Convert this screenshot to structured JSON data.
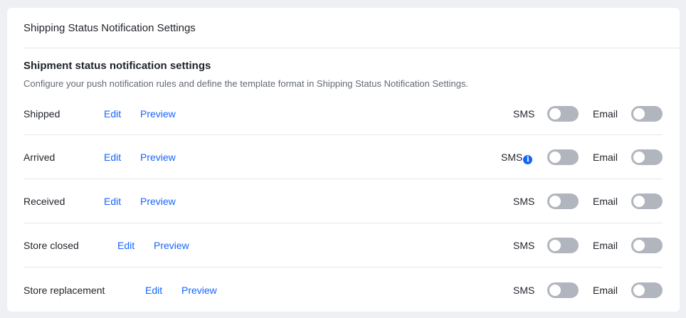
{
  "card": {
    "title": "Shipping Status Notification Settings"
  },
  "section": {
    "title": "Shipment status notification settings",
    "description": "Configure your push notification rules and define the template format in Shipping Status Notification Settings."
  },
  "rows": [
    {
      "label": "Shipped",
      "edit": "Edit",
      "preview": "Preview",
      "sms_label": "SMS",
      "email_label": "Email",
      "sms_enabled": false,
      "email_enabled": false
    },
    {
      "label": "Arrived",
      "edit": "Edit",
      "preview": "Preview",
      "sms_label": "SMS",
      "email_label": "Email",
      "sms_enabled": false,
      "email_enabled": false,
      "sms_info_icon": "info-icon"
    },
    {
      "label": "Received",
      "edit": "Edit",
      "preview": "Preview",
      "sms_label": "SMS",
      "email_label": "Email",
      "sms_enabled": false,
      "email_enabled": false
    },
    {
      "label": "Store closed",
      "edit": "Edit",
      "preview": "Preview",
      "sms_label": "SMS",
      "email_label": "Email",
      "sms_enabled": false,
      "email_enabled": false
    },
    {
      "label": "Store replacement",
      "edit": "Edit",
      "preview": "Preview",
      "sms_label": "SMS",
      "email_label": "Email",
      "sms_enabled": false,
      "email_enabled": false
    }
  ],
  "colors": {
    "link": "#1664ff",
    "toggle_off": "#b1b5bd",
    "background": "#eef0f3"
  }
}
